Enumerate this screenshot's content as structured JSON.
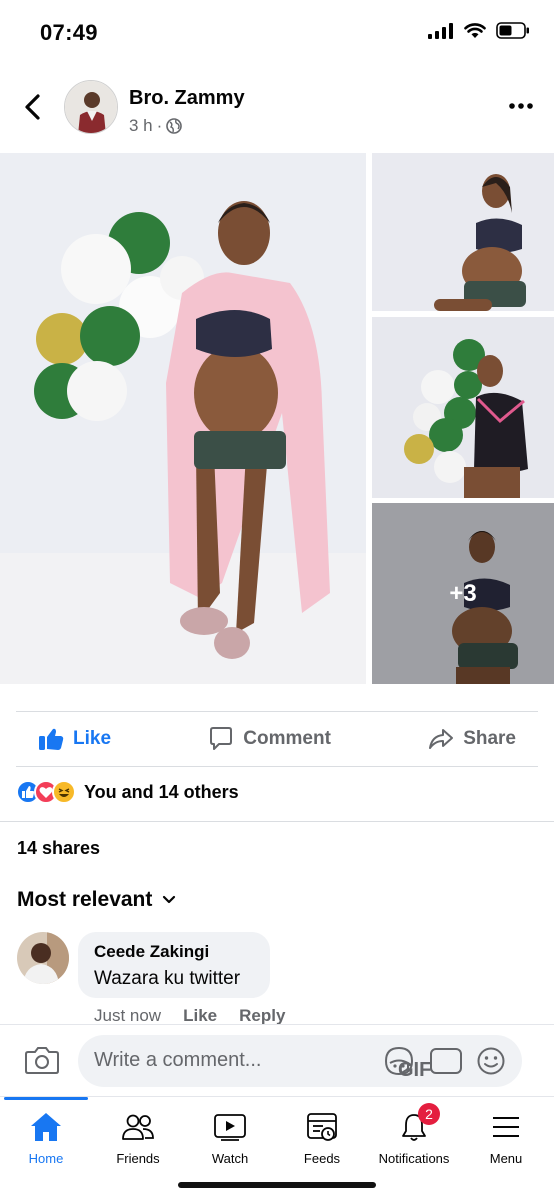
{
  "status_bar": {
    "time": "07:49"
  },
  "post": {
    "author": "Bro. Zammy",
    "time": "3 h",
    "separator": "·",
    "privacy_icon": "globe-icon",
    "photos_more_label": "+3"
  },
  "actions": {
    "like": "Like",
    "comment": "Comment",
    "share": "Share",
    "like_active": true
  },
  "reactions": {
    "icons": [
      "like",
      "love",
      "haha"
    ],
    "text": "You and 14 others"
  },
  "shares": "14 shares",
  "comments_sort": "Most relevant",
  "comments": [
    {
      "author": "Ceede Zakingi",
      "text": "Wazara ku twitter",
      "time": "Just now",
      "like": "Like",
      "reply": "Reply"
    }
  ],
  "composer": {
    "placeholder": "Write a comment...",
    "gif": "GIF"
  },
  "tabs": [
    {
      "label": "Home",
      "icon": "home-icon",
      "active": true
    },
    {
      "label": "Friends",
      "icon": "friends-icon"
    },
    {
      "label": "Watch",
      "icon": "watch-icon"
    },
    {
      "label": "Feeds",
      "icon": "feeds-icon"
    },
    {
      "label": "Notifications",
      "icon": "bell-icon",
      "badge": "2"
    },
    {
      "label": "Menu",
      "icon": "menu-icon"
    }
  ],
  "colors": {
    "accent": "#1877f2",
    "secondary_text": "#65676b",
    "badge": "#e41e3f"
  }
}
